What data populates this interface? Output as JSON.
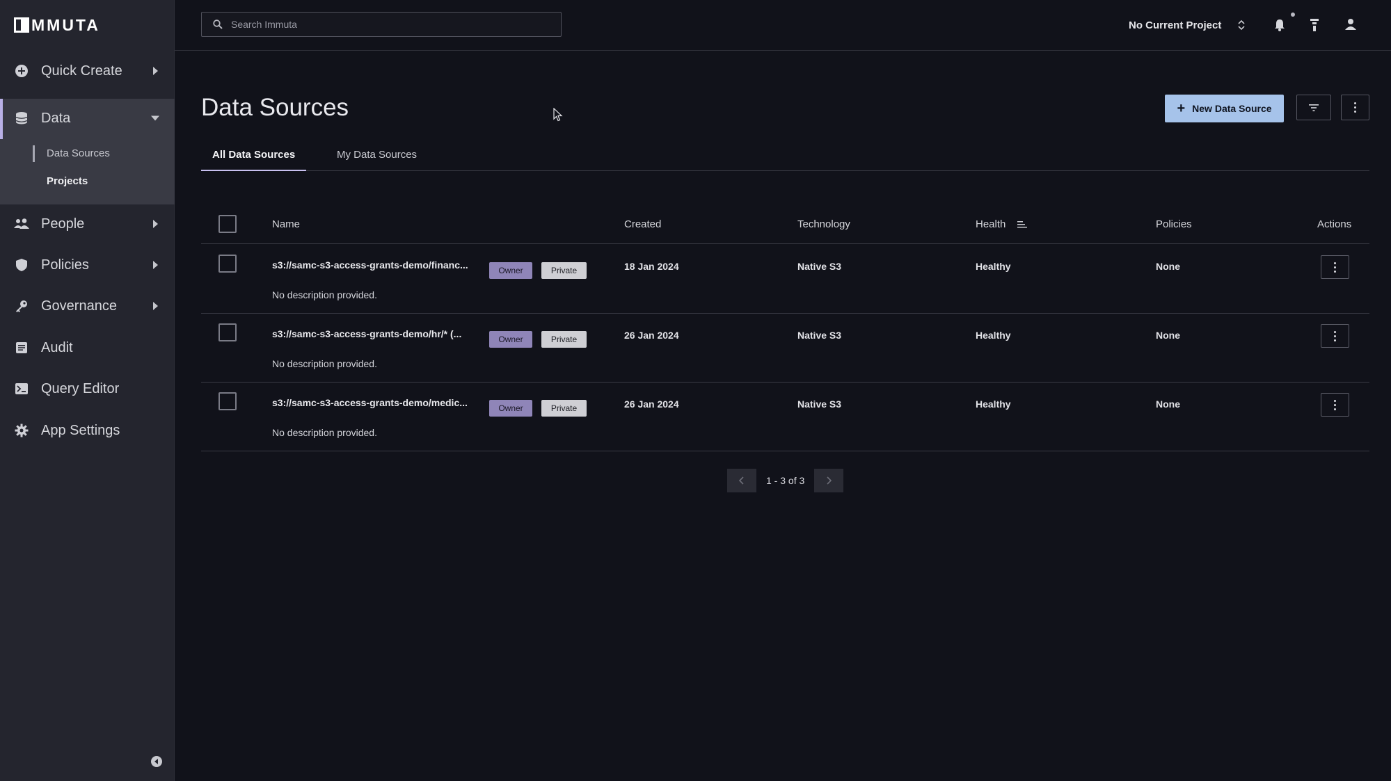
{
  "brand": {
    "logo_text": "MMUTA"
  },
  "sidebar": {
    "items": [
      {
        "label": "Quick Create",
        "icon": "plus-circle-icon"
      },
      {
        "label": "Data",
        "icon": "database-icon"
      },
      {
        "label": "People",
        "icon": "people-icon"
      },
      {
        "label": "Policies",
        "icon": "shield-icon"
      },
      {
        "label": "Governance",
        "icon": "key-icon"
      },
      {
        "label": "Audit",
        "icon": "audit-log-icon"
      },
      {
        "label": "Query Editor",
        "icon": "terminal-icon"
      },
      {
        "label": "App Settings",
        "icon": "gear-icon"
      }
    ],
    "data_subitems": [
      {
        "label": "Data Sources"
      },
      {
        "label": "Projects"
      }
    ]
  },
  "topbar": {
    "search_placeholder": "Search Immuta",
    "project": "No Current Project"
  },
  "page": {
    "title": "Data Sources",
    "new_button": "New Data Source",
    "tabs": [
      {
        "label": "All Data Sources",
        "active": true
      },
      {
        "label": "My Data Sources",
        "active": false
      }
    ]
  },
  "table": {
    "headers": {
      "name": "Name",
      "created": "Created",
      "technology": "Technology",
      "health": "Health",
      "policies": "Policies",
      "actions": "Actions"
    },
    "rows": [
      {
        "name": "s3://samc-s3-access-grants-demo/financ...",
        "owner": "Owner",
        "visibility": "Private",
        "created": "18 Jan 2024",
        "technology": "Native S3",
        "health": "Healthy",
        "policies": "None",
        "description": "No description provided."
      },
      {
        "name": "s3://samc-s3-access-grants-demo/hr/* (...",
        "owner": "Owner",
        "visibility": "Private",
        "created": "26 Jan 2024",
        "technology": "Native S3",
        "health": "Healthy",
        "policies": "None",
        "description": "No description provided."
      },
      {
        "name": "s3://samc-s3-access-grants-demo/medic...",
        "owner": "Owner",
        "visibility": "Private",
        "created": "26 Jan 2024",
        "technology": "Native S3",
        "health": "Healthy",
        "policies": "None",
        "description": "No description provided."
      }
    ]
  },
  "pagination": {
    "label": "1 - 3 of 3"
  },
  "colors": {
    "primary_button": "#a6c3ea",
    "owner_badge": "#8f85b8",
    "private_badge": "#cfcfd4",
    "background": "#11121a",
    "sidebar": "#24252e"
  }
}
